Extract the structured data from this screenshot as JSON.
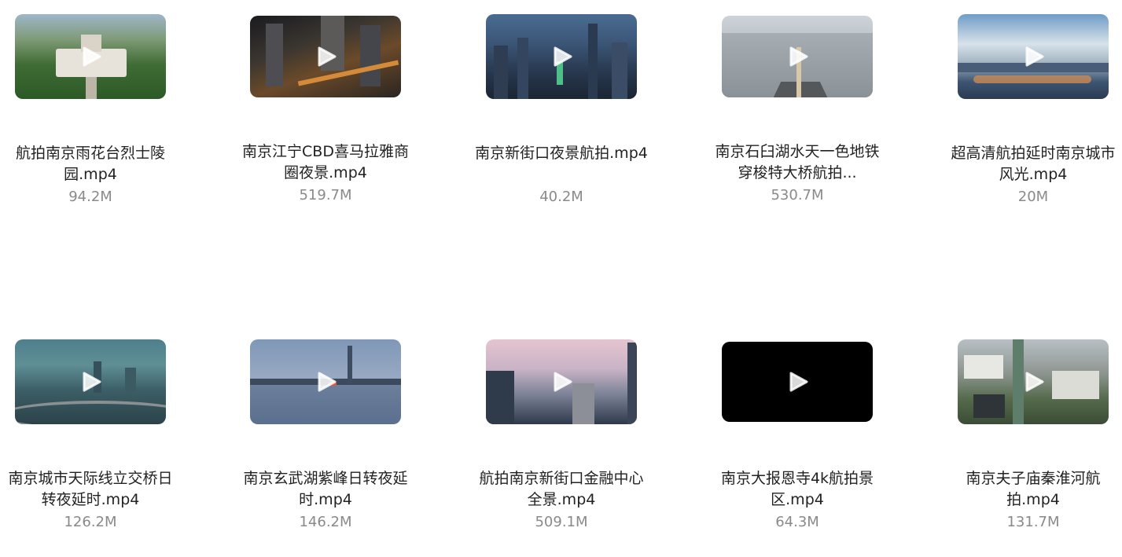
{
  "videos": [
    {
      "title": "航拍南京雨花台烈士陵园.mp4",
      "size": "94.2M",
      "play_icon": "play-icon"
    },
    {
      "title": "南京江宁CBD喜马拉雅商圈夜景.mp4",
      "size": "519.7M",
      "play_icon": "play-icon"
    },
    {
      "title": "南京新街口夜景航拍.mp4",
      "size": "40.2M",
      "play_icon": "play-icon"
    },
    {
      "title": "南京石臼湖水天一色地铁穿梭特大桥航拍...",
      "size": "530.7M",
      "play_icon": "play-icon"
    },
    {
      "title": "超高清航拍延时南京城市风光.mp4",
      "size": "20M",
      "play_icon": "play-icon"
    },
    {
      "title": "南京城市天际线立交桥日转夜延时.mp4",
      "size": "126.2M",
      "play_icon": "play-icon"
    },
    {
      "title": "南京玄武湖紫峰日转夜延时.mp4",
      "size": "146.2M",
      "play_icon": "play-icon"
    },
    {
      "title": "航拍南京新街口金融中心全景.mp4",
      "size": "509.1M",
      "play_icon": "play-icon"
    },
    {
      "title": "南京大报恩寺4k航拍景区.mp4",
      "size": "64.3M",
      "play_icon": "play-icon"
    },
    {
      "title": "南京夫子庙秦淮河航拍.mp4",
      "size": "131.7M",
      "play_icon": "play-icon"
    }
  ]
}
